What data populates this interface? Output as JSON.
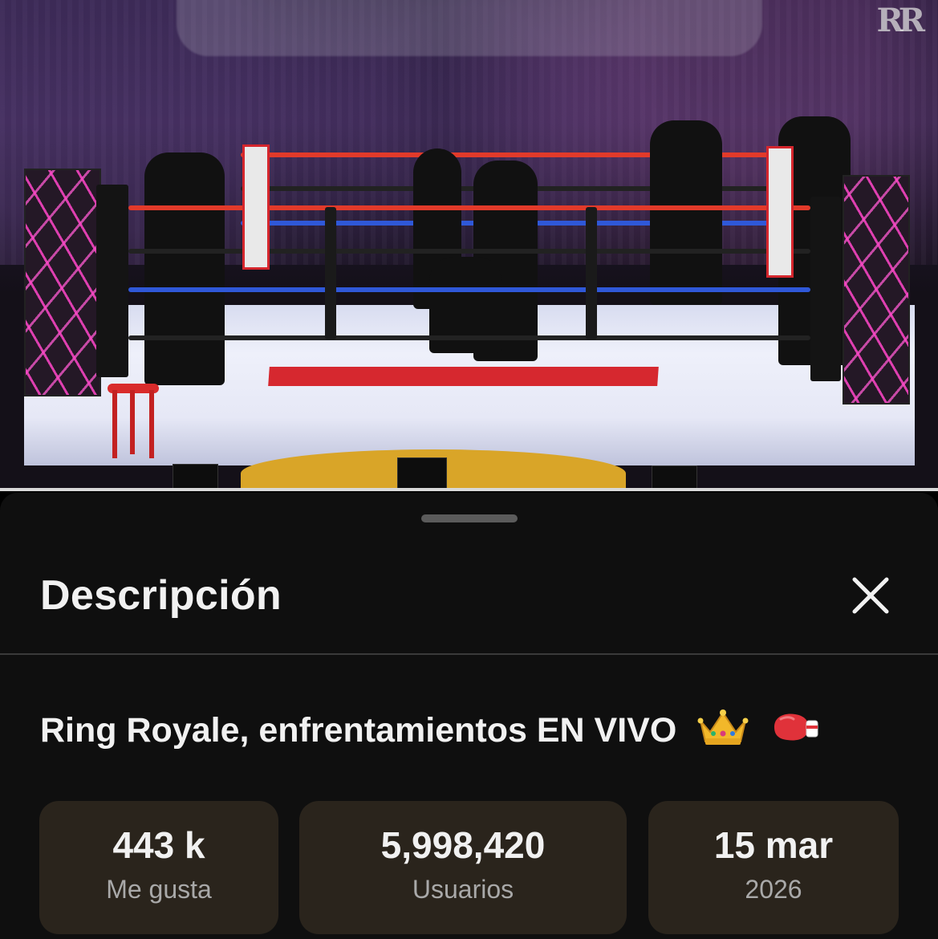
{
  "video": {
    "watermark": "RR"
  },
  "sheet": {
    "title": "Descripción",
    "close_icon": "close-icon",
    "video_title": "Ring Royale, enfrentamientos EN VIVO",
    "title_emojis": [
      "crown-icon",
      "boxing-glove-icon"
    ],
    "stats": [
      {
        "value": "443 k",
        "label": "Me gusta"
      },
      {
        "value": "5,998,420",
        "label": "Usuarios"
      },
      {
        "value": "15 mar",
        "label": "2026"
      }
    ]
  },
  "colors": {
    "sheet_bg": "#0f0f0f",
    "card_bg": "#2a241c",
    "text_primary": "#f1f1f1",
    "text_secondary": "#a9a9a9"
  }
}
